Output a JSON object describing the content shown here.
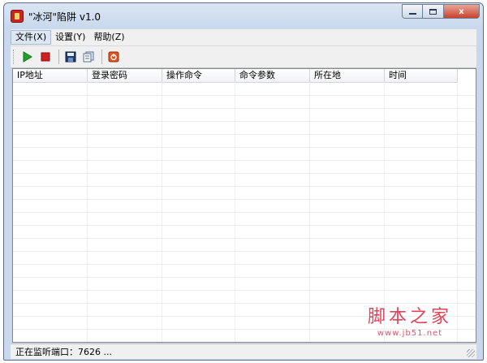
{
  "window": {
    "title": "\"冰河\"陷阱 v1.0",
    "controls": {
      "close_glyph": "x"
    }
  },
  "menu": {
    "items": [
      {
        "label": "文件(X)"
      },
      {
        "label": "设置(Y)"
      },
      {
        "label": "帮助(Z)"
      }
    ]
  },
  "toolbar": {
    "icons": [
      "play-icon",
      "stop-icon",
      "save-icon",
      "copy-icon",
      "exit-icon"
    ]
  },
  "table": {
    "columns": [
      "IP地址",
      "登录密码",
      "操作命令",
      "命令参数",
      "所在地",
      "时间"
    ],
    "rows": []
  },
  "status": {
    "text": "正在监听端口：7626 ..."
  },
  "watermark": {
    "main": "脚本之家",
    "url": "www.jb51.net"
  },
  "colors": {
    "accent_red": "#d02020",
    "accent_green": "#22a02a",
    "watermark": "#e0435a"
  }
}
